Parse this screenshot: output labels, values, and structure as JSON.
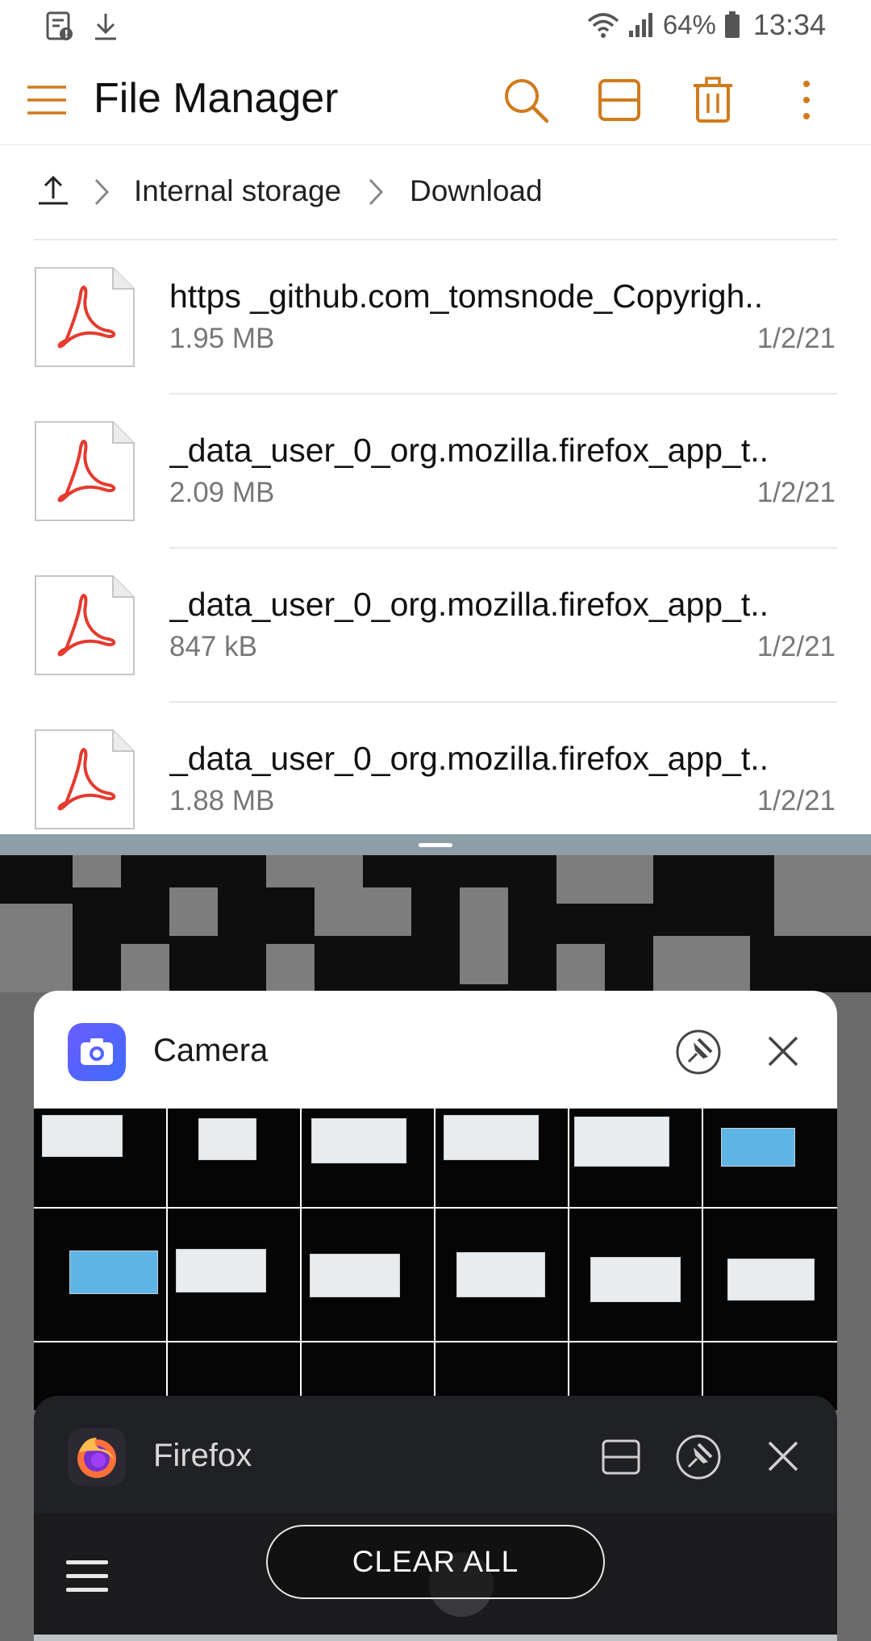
{
  "status_bar": {
    "battery_percent": "64%",
    "time": "13:34",
    "left_icons": [
      "sim-card-alert-icon",
      "download-icon"
    ],
    "right_icons": [
      "wifi-icon",
      "signal-icon",
      "battery-icon"
    ]
  },
  "app_bar": {
    "title": "File Manager",
    "accent_color": "#d17a1b",
    "actions": [
      "search-icon",
      "split-view-icon",
      "delete-icon",
      "more-icon"
    ]
  },
  "breadcrumb": {
    "items": [
      "Internal storage",
      "Download"
    ]
  },
  "files": [
    {
      "name": "https _github.com_tomsnode_Copyrigh..",
      "size": "1.95 MB",
      "date": "1/2/21",
      "type": "pdf"
    },
    {
      "name": "_data_user_0_org.mozilla.firefox_app_t..",
      "size": "2.09 MB",
      "date": "1/2/21",
      "type": "pdf"
    },
    {
      "name": "_data_user_0_org.mozilla.firefox_app_t..",
      "size": "847 kB",
      "date": "1/2/21",
      "type": "pdf"
    },
    {
      "name": "_data_user_0_org.mozilla.firefox_app_t..",
      "size": "1.88 MB",
      "date": "1/2/21",
      "type": "pdf"
    }
  ],
  "recents": {
    "cards": [
      {
        "app": "Camera",
        "icon": "camera-icon",
        "controls": [
          "pin-icon",
          "close-icon"
        ]
      },
      {
        "app": "Firefox",
        "icon": "firefox-icon",
        "controls": [
          "split-view-icon",
          "pin-icon",
          "close-icon"
        ]
      }
    ],
    "clear_all_label": "CLEAR ALL"
  }
}
